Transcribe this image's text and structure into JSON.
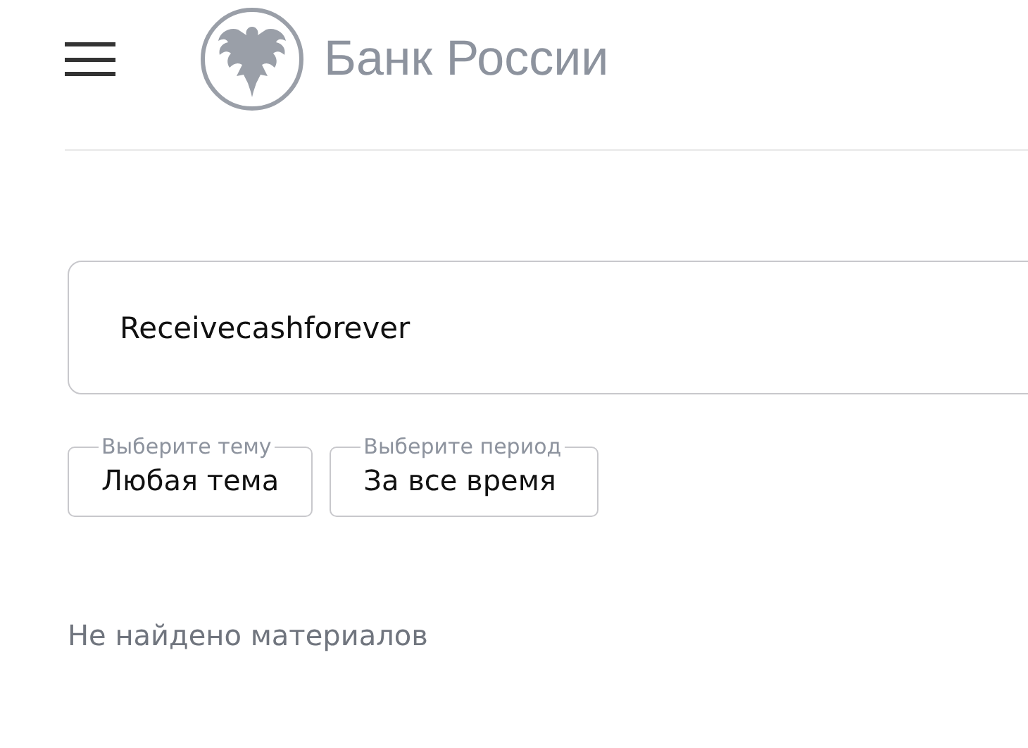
{
  "header": {
    "brand": "Банк России"
  },
  "search": {
    "value": "Receivecashforever"
  },
  "filters": [
    {
      "label": "Выберите тему",
      "value": "Любая тема"
    },
    {
      "label": "Выберите период",
      "value": "За все время"
    }
  ],
  "results": {
    "message": "Не найдено материалов"
  }
}
